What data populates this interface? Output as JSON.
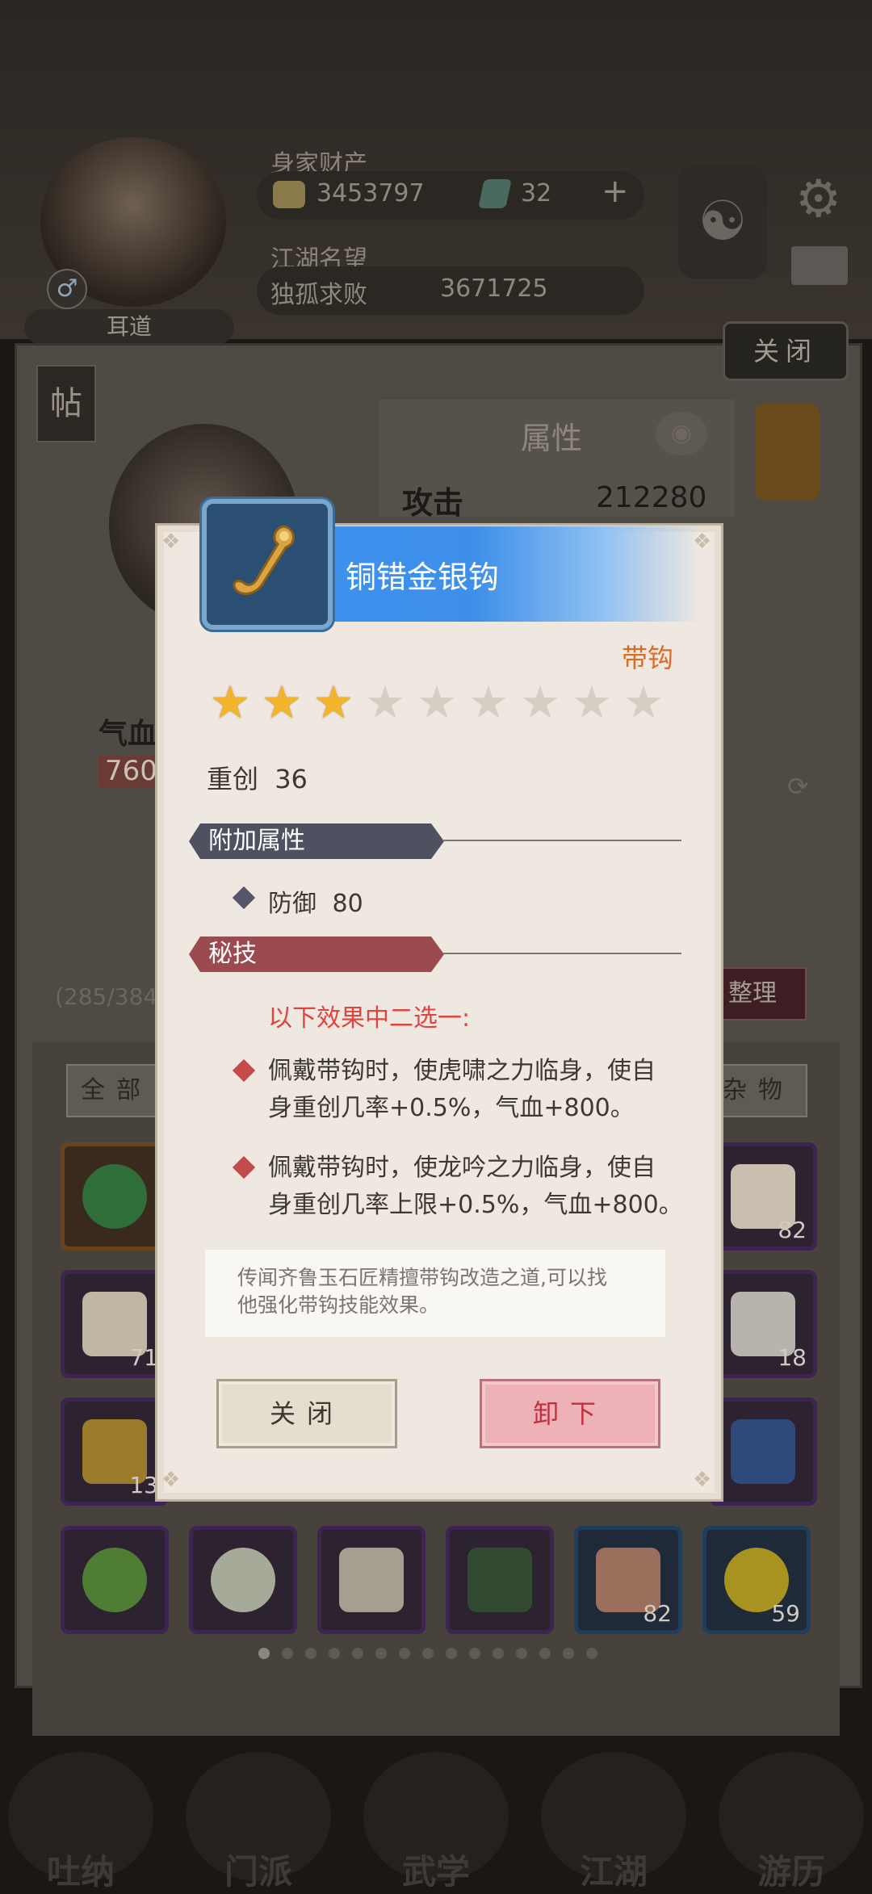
{
  "background": {
    "player_name": "耳道",
    "wealth_label": "身家财产",
    "gold": "3453797",
    "jade": "32",
    "plus": "+",
    "fame_label": "江湖名望",
    "fame_title": "独孤求败",
    "fame_value": "3671725",
    "close_top": "关闭",
    "tie_label": "帖",
    "attr_title": "属性",
    "attack_label": "攻击",
    "attack_value": "212280",
    "qixue_label": "气血",
    "qixue_value": "760",
    "bag_count": "(285/384",
    "sort_label": "整理",
    "tab_all": "全部",
    "tab_misc": "杂物",
    "slot_counts": [
      "82",
      "71",
      "18",
      "13",
      "82",
      "59"
    ],
    "nav": [
      "吐纳",
      "门派",
      "武学",
      "江湖",
      "游历"
    ]
  },
  "item": {
    "name": "铜错金银钩",
    "type": "带钩",
    "stars_filled": 3,
    "stars_total": 9,
    "main_attr_name": "重创",
    "main_attr_value": "36",
    "extra_section": "附加属性",
    "extra_attr_name": "防御",
    "extra_attr_value": "80",
    "skill_section": "秘技",
    "choose_text": "以下效果中二选一:",
    "effect1_line1": "佩戴带钩时，使虎啸之力临身，使自",
    "effect1_line2": "身重创几率+0.5%，气血+800。",
    "effect2_line1": "佩戴带钩时，使龙吟之力临身，使自",
    "effect2_line2": "身重创几率上限+0.5%，气血+800。",
    "description_line1": "传闻齐鲁玉石匠精擅带钩改造之道,可以找",
    "description_line2": "他强化带钩技能效果。",
    "btn_close": "关闭",
    "btn_unequip": "卸下"
  },
  "colors": {
    "header_blue": "#3b93ef",
    "type_orange": "#d86d2a",
    "star_gold": "#f2b42b",
    "choose_red": "#e04440"
  }
}
